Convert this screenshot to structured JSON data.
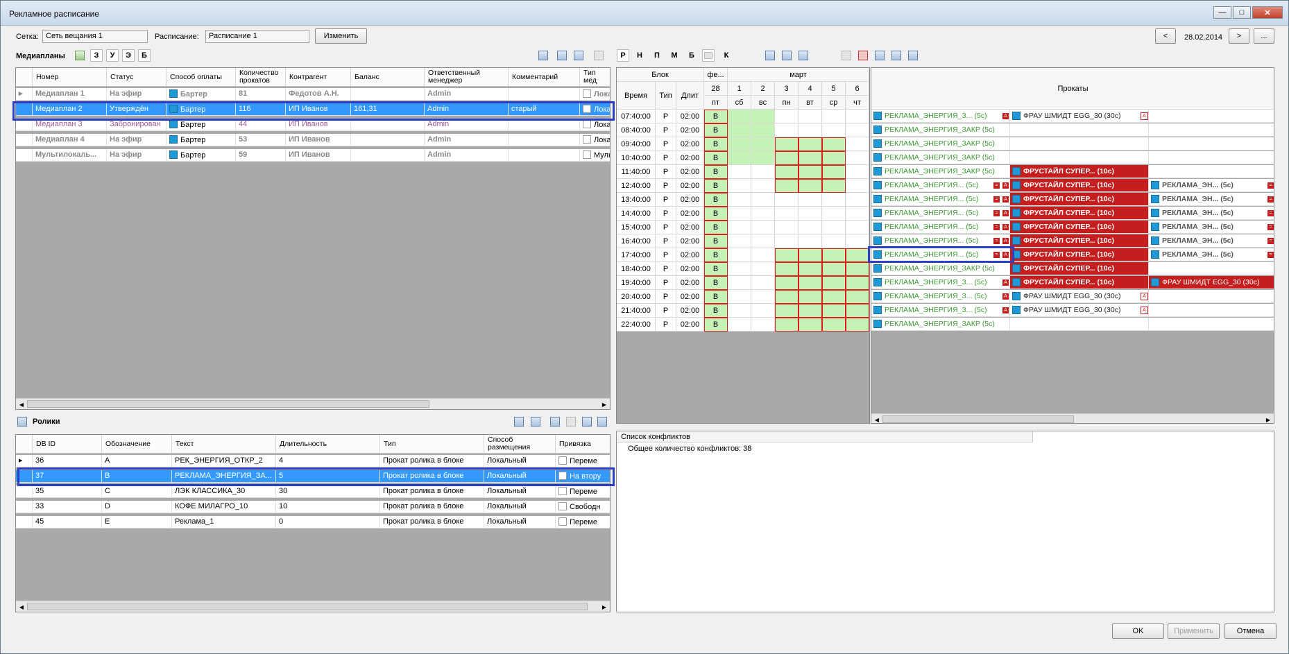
{
  "window": {
    "title": "Рекламное расписание"
  },
  "topbar": {
    "grid_label": "Сетка:",
    "grid_value": "Сеть вещания 1",
    "schedule_label": "Расписание:",
    "schedule_value": "Расписание 1",
    "change_button": "Изменить",
    "prev_button": "<",
    "date": "28.02.2014",
    "next_button": ">",
    "more_button": "..."
  },
  "mediaplans": {
    "title": "Медиапланы",
    "filters": [
      "З",
      "У",
      "Э",
      "Б"
    ],
    "columns": [
      "Номер",
      "Статус",
      "Способ оплаты",
      "Количество прокатов",
      "Контрагент",
      "Баланс",
      "Ответственный менеджер",
      "Комментарий",
      "Тип мед"
    ],
    "rows": [
      {
        "num": "Медиаплан 1",
        "status": "На эфир",
        "pay": "Бартер",
        "count": "81",
        "contr": "Федотов А.Н.",
        "bal": "",
        "mgr": "Admin",
        "comm": "",
        "type": "Лока"
      },
      {
        "num": "Медиаплан 2",
        "status": "Утверждён",
        "pay": "Бартер",
        "count": "116",
        "contr": "ИП Иванов",
        "bal": "161,31",
        "mgr": "Admin",
        "comm": "старый",
        "type": "Лока"
      },
      {
        "num": "Медиаплан 3",
        "status": "Забронирован",
        "pay": "Бартер",
        "count": "44",
        "contr": "ИП Иванов",
        "bal": "",
        "mgr": "Admin",
        "comm": "",
        "type": "Лока"
      },
      {
        "num": "Медиаплан 4",
        "status": "На эфир",
        "pay": "Бартер",
        "count": "53",
        "contr": "ИП Иванов",
        "bal": "",
        "mgr": "Admin",
        "comm": "",
        "type": "Лока"
      },
      {
        "num": "Мультилокаль...",
        "status": "На эфир",
        "pay": "Бартер",
        "count": "59",
        "contr": "ИП Иванов",
        "bal": "",
        "mgr": "Admin",
        "comm": "",
        "type": "Муль"
      }
    ]
  },
  "clips": {
    "title": "Ролики",
    "columns": [
      "DB ID",
      "Обозначение",
      "Текст",
      "Длительность",
      "Тип",
      "Способ размещения",
      "Привязка"
    ],
    "rows": [
      {
        "id": "36",
        "code": "A",
        "text": "РЕК_ЭНЕРГИЯ_ОТКР_2",
        "dur": "4",
        "type": "Прокат ролика в блоке",
        "place": "Локальный",
        "bind": "Переме"
      },
      {
        "id": "37",
        "code": "B",
        "text": "РЕКЛАМА_ЭНЕРГИЯ_ЗА...",
        "dur": "5",
        "type": "Прокат ролика в блоке",
        "place": "Локальный",
        "bind": "На втору"
      },
      {
        "id": "35",
        "code": "C",
        "text": "ЛЭК КЛАССИКА_30",
        "dur": "30",
        "type": "Прокат ролика в блоке",
        "place": "Локальный",
        "bind": "Переме"
      },
      {
        "id": "33",
        "code": "D",
        "text": "КОФЕ МИЛАГРО_10",
        "dur": "10",
        "type": "Прокат ролика в блоке",
        "place": "Локальный",
        "bind": "Свободн"
      },
      {
        "id": "45",
        "code": "E",
        "text": "Реклама_1",
        "dur": "0",
        "type": "Прокат ролика в блоке",
        "place": "Локальный",
        "bind": "Переме"
      }
    ]
  },
  "schedule": {
    "letters": [
      "Р",
      "Н",
      "П",
      "М",
      "Б",
      "К"
    ],
    "block_header": "Блок",
    "feb_header": "фе...",
    "month_header": "март",
    "col_time": "Время",
    "col_type": "Тип",
    "col_dur": "Длит",
    "days": [
      "28",
      "1",
      "2",
      "3",
      "4",
      "5",
      "6"
    ],
    "weekdays": [
      "пт",
      "сб",
      "вс",
      "пн",
      "вт",
      "ср",
      "чт"
    ],
    "prokaty_header": "Прокаты",
    "times": [
      "07:40:00",
      "08:40:00",
      "09:40:00",
      "10:40:00",
      "11:40:00",
      "12:40:00",
      "13:40:00",
      "14:40:00",
      "15:40:00",
      "16:40:00",
      "17:40:00",
      "18:40:00",
      "19:40:00",
      "20:40:00",
      "21:40:00",
      "22:40:00"
    ],
    "type_val": "Р",
    "dur_val": "02:00",
    "b_val": "B",
    "ads": {
      "zakr": "РЕКЛАМА_ЭНЕРГИЯ_ЗАКР (5с)",
      "z3": "РЕКЛАМА_ЭНЕРГИЯ_З... (5с)",
      "e_short": "РЕКЛАМА_ЭНЕРГИЯ... (5с)",
      "frau": "ФРАУ ШМИДТ EGG_30 (30с)",
      "frust": "ФРУСТАЙЛ СУПЕР... (10с)",
      "en_short": "РЕКЛАМА_ЭН... (5с)"
    }
  },
  "conflicts": {
    "header": "Список конфликтов",
    "text": "Общее количество конфликтов: 38"
  },
  "footer": {
    "ok": "OK",
    "apply": "Применить",
    "cancel": "Отмена"
  }
}
